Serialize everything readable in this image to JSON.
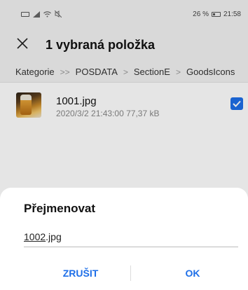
{
  "statusbar": {
    "battery": "26 %",
    "time": "21:58"
  },
  "titlebar": {
    "title": "1 vybraná položka"
  },
  "breadcrumb": [
    "Kategorie",
    "POSDATA",
    "SectionE",
    "GoodsIcons"
  ],
  "file": {
    "name": "1001.jpg",
    "meta": "2020/3/2 21:43:00 77,37 kB",
    "checked": true
  },
  "dialog": {
    "title": "Přejmenovat",
    "input_value_base": "1002",
    "input_value_ext": ".jpg",
    "cancel_label": "ZRUŠIT",
    "ok_label": "OK"
  },
  "colors": {
    "accent": "#1e6fe8",
    "background": "#f2f2f2"
  }
}
